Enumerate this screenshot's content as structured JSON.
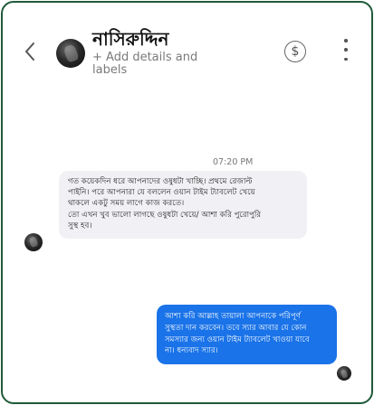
{
  "header": {
    "contact_name": "নাসিরুদ্দিন",
    "add_details_label": "+ Add details and labels",
    "icons": {
      "back": "chevron-left-icon",
      "avatar": "contact-avatar",
      "payment": "dollar-circle-icon",
      "more": "more-vertical-icon"
    }
  },
  "conversation": {
    "timestamp": "07:20 PM",
    "incoming": {
      "lines": [
        "গত কয়েকদিন ধরে আপনাদের ওষুধটা খাচ্ছি। প্রথমে রেজাল্ট",
        "পাইনি। পরে আপনারা যে বললেন ওয়ান টাইম ট্যাবলেট খেয়ে",
        "থাকলে একটু সময় লাগে কাজ করতে।",
        "তো এখন খুব ভালো লাগছে ওষুধটা খেয়ে/ আশা করি পুরোপুরি",
        "সুস্থ হব।"
      ]
    },
    "outgoing": {
      "lines": [
        "আশা করি আল্লাহ তায়ালা আপনাকে পরিপূর্ণ",
        "সুস্থতা দান করবেন। তবে স্যার আবার যে কোন",
        "সমস্যার জন্য ওয়ান টাইম ট্যাবলেট খাওয়া যাবে",
        "না। ধন্যবাদ স্যার।"
      ]
    }
  },
  "colors": {
    "frame_border": "#1f5a3a",
    "incoming_bubble": "#f1f1f5",
    "outgoing_bubble": "#1a73e8"
  }
}
